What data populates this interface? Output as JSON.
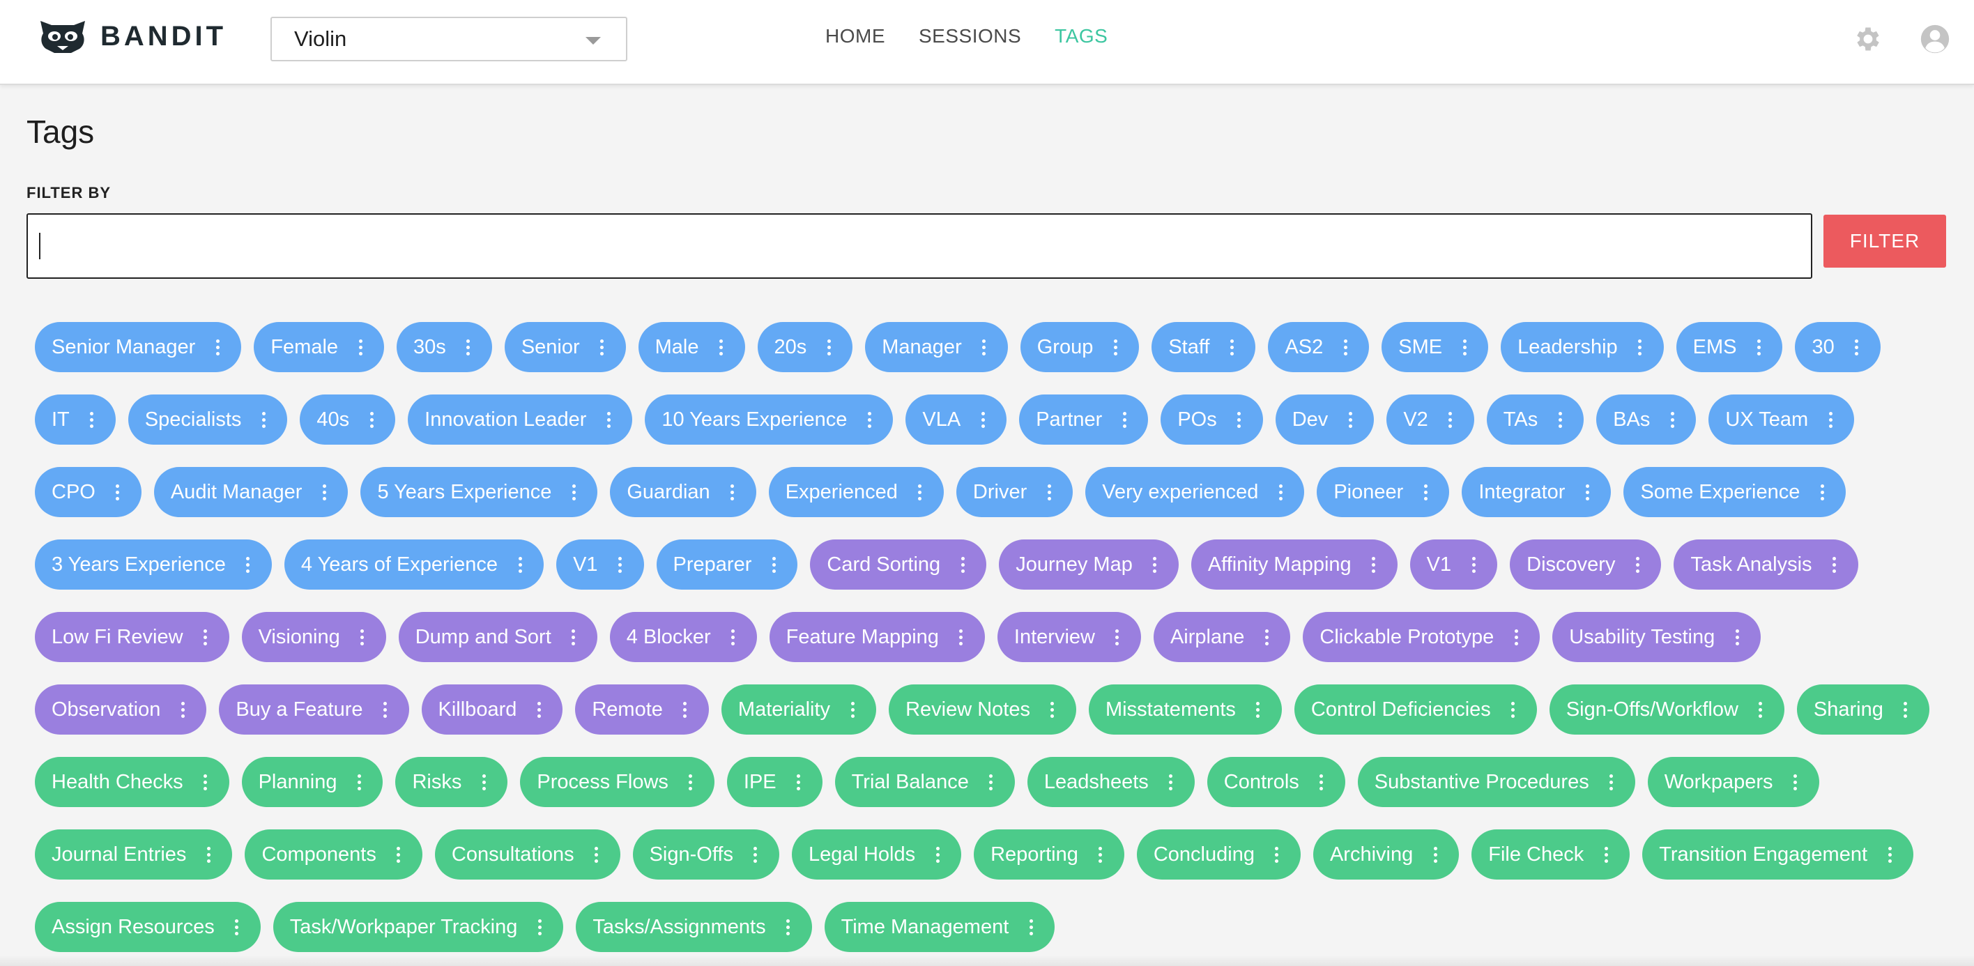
{
  "app": {
    "brand": "BANDIT"
  },
  "session_select": {
    "value": "Violin"
  },
  "nav": {
    "items": [
      {
        "label": "HOME",
        "active": false
      },
      {
        "label": "SESSIONS",
        "active": false
      },
      {
        "label": "TAGS",
        "active": true
      }
    ]
  },
  "header_icons": {
    "settings": "gear-icon",
    "account": "user-icon"
  },
  "page": {
    "title": "Tags"
  },
  "filter": {
    "label": "FILTER BY",
    "value": "",
    "placeholder": "",
    "button_label": "FILTER"
  },
  "colors": {
    "blue": "#63a9f5",
    "purple": "#9a7fdf",
    "green": "#4ccb8a",
    "filter_button": "#ec5a5e",
    "nav_active": "#3cc6a0"
  },
  "tags": [
    {
      "label": "Senior Manager",
      "color": "blue"
    },
    {
      "label": "Female",
      "color": "blue"
    },
    {
      "label": "30s",
      "color": "blue"
    },
    {
      "label": "Senior",
      "color": "blue"
    },
    {
      "label": "Male",
      "color": "blue"
    },
    {
      "label": "20s",
      "color": "blue"
    },
    {
      "label": "Manager",
      "color": "blue"
    },
    {
      "label": "Group",
      "color": "blue"
    },
    {
      "label": "Staff",
      "color": "blue"
    },
    {
      "label": "AS2",
      "color": "blue"
    },
    {
      "label": "SME",
      "color": "blue"
    },
    {
      "label": "Leadership",
      "color": "blue"
    },
    {
      "label": "EMS",
      "color": "blue"
    },
    {
      "label": "30",
      "color": "blue"
    },
    {
      "label": "IT",
      "color": "blue"
    },
    {
      "label": "Specialists",
      "color": "blue"
    },
    {
      "label": "40s",
      "color": "blue"
    },
    {
      "label": "Innovation Leader",
      "color": "blue"
    },
    {
      "label": "10 Years Experience",
      "color": "blue"
    },
    {
      "label": "VLA",
      "color": "blue"
    },
    {
      "label": "Partner",
      "color": "blue"
    },
    {
      "label": "POs",
      "color": "blue"
    },
    {
      "label": "Dev",
      "color": "blue"
    },
    {
      "label": "V2",
      "color": "blue"
    },
    {
      "label": "TAs",
      "color": "blue"
    },
    {
      "label": "BAs",
      "color": "blue"
    },
    {
      "label": "UX Team",
      "color": "blue"
    },
    {
      "label": "CPO",
      "color": "blue"
    },
    {
      "label": "Audit Manager",
      "color": "blue"
    },
    {
      "label": "5 Years Experience",
      "color": "blue"
    },
    {
      "label": "Guardian",
      "color": "blue"
    },
    {
      "label": "Experienced",
      "color": "blue"
    },
    {
      "label": "Driver",
      "color": "blue"
    },
    {
      "label": "Very experienced",
      "color": "blue"
    },
    {
      "label": "Pioneer",
      "color": "blue"
    },
    {
      "label": "Integrator",
      "color": "blue"
    },
    {
      "label": "Some Experience",
      "color": "blue"
    },
    {
      "label": "3 Years Experience",
      "color": "blue"
    },
    {
      "label": "4 Years of Experience",
      "color": "blue"
    },
    {
      "label": "V1",
      "color": "blue"
    },
    {
      "label": "Preparer",
      "color": "blue"
    },
    {
      "label": "Card Sorting",
      "color": "purple"
    },
    {
      "label": "Journey Map",
      "color": "purple"
    },
    {
      "label": "Affinity Mapping",
      "color": "purple"
    },
    {
      "label": "V1",
      "color": "purple"
    },
    {
      "label": "Discovery",
      "color": "purple"
    },
    {
      "label": "Task Analysis",
      "color": "purple"
    },
    {
      "label": "Low Fi Review",
      "color": "purple"
    },
    {
      "label": "Visioning",
      "color": "purple"
    },
    {
      "label": "Dump and Sort",
      "color": "purple"
    },
    {
      "label": "4 Blocker",
      "color": "purple"
    },
    {
      "label": "Feature Mapping",
      "color": "purple"
    },
    {
      "label": "Interview",
      "color": "purple"
    },
    {
      "label": "Airplane",
      "color": "purple"
    },
    {
      "label": "Clickable Prototype",
      "color": "purple"
    },
    {
      "label": "Usability Testing",
      "color": "purple"
    },
    {
      "label": "Observation",
      "color": "purple"
    },
    {
      "label": "Buy a Feature",
      "color": "purple"
    },
    {
      "label": "Killboard",
      "color": "purple"
    },
    {
      "label": "Remote",
      "color": "purple"
    },
    {
      "label": "Materiality",
      "color": "green"
    },
    {
      "label": "Review Notes",
      "color": "green"
    },
    {
      "label": "Misstatements",
      "color": "green"
    },
    {
      "label": "Control Deficiencies",
      "color": "green"
    },
    {
      "label": "Sign-Offs/Workflow",
      "color": "green"
    },
    {
      "label": "Sharing",
      "color": "green"
    },
    {
      "label": "Health Checks",
      "color": "green"
    },
    {
      "label": "Planning",
      "color": "green"
    },
    {
      "label": "Risks",
      "color": "green"
    },
    {
      "label": "Process Flows",
      "color": "green"
    },
    {
      "label": "IPE",
      "color": "green"
    },
    {
      "label": "Trial Balance",
      "color": "green"
    },
    {
      "label": "Leadsheets",
      "color": "green"
    },
    {
      "label": "Controls",
      "color": "green"
    },
    {
      "label": "Substantive Procedures",
      "color": "green"
    },
    {
      "label": "Workpapers",
      "color": "green"
    },
    {
      "label": "Journal Entries",
      "color": "green"
    },
    {
      "label": "Components",
      "color": "green"
    },
    {
      "label": "Consultations",
      "color": "green"
    },
    {
      "label": "Sign-Offs",
      "color": "green"
    },
    {
      "label": "Legal Holds",
      "color": "green"
    },
    {
      "label": "Reporting",
      "color": "green"
    },
    {
      "label": "Concluding",
      "color": "green"
    },
    {
      "label": "Archiving",
      "color": "green"
    },
    {
      "label": "File Check",
      "color": "green"
    },
    {
      "label": "Transition Engagement",
      "color": "green"
    },
    {
      "label": "Assign Resources",
      "color": "green"
    },
    {
      "label": "Task/Workpaper Tracking",
      "color": "green"
    },
    {
      "label": "Tasks/Assignments",
      "color": "green"
    },
    {
      "label": "Time Management",
      "color": "green"
    }
  ]
}
